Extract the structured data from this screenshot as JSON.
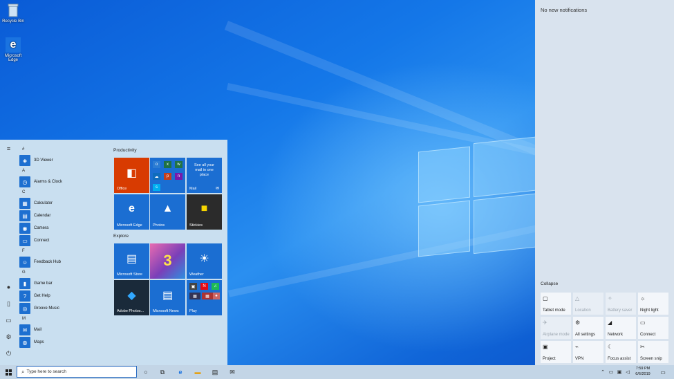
{
  "desktop": {
    "icons": [
      {
        "label": "Recycle Bin",
        "icon": "recycle-bin-icon"
      },
      {
        "label": "Microsoft Edge",
        "icon": "edge-icon"
      }
    ]
  },
  "action_center": {
    "no_notifications": "No new notifications",
    "collapse": "Collapse",
    "quick_actions": [
      {
        "label": "Tablet mode",
        "icon": "tablet-icon",
        "glyph": "▢",
        "enabled": true
      },
      {
        "label": "Location",
        "icon": "location-icon",
        "glyph": "△",
        "enabled": false
      },
      {
        "label": "Battery saver",
        "icon": "battery-icon",
        "glyph": "✧",
        "enabled": false
      },
      {
        "label": "Night light",
        "icon": "brightness-icon",
        "glyph": "☼",
        "enabled": true
      },
      {
        "label": "Airplane mode",
        "icon": "airplane-icon",
        "glyph": "✈",
        "enabled": false
      },
      {
        "label": "All settings",
        "icon": "gear-icon",
        "glyph": "⚙",
        "enabled": true
      },
      {
        "label": "Network",
        "icon": "network-icon",
        "glyph": "◢",
        "enabled": true
      },
      {
        "label": "Connect",
        "icon": "connect-icon",
        "glyph": "▭",
        "enabled": true
      },
      {
        "label": "Project",
        "icon": "project-icon",
        "glyph": "▣",
        "enabled": true
      },
      {
        "label": "VPN",
        "icon": "vpn-icon",
        "glyph": "⌁",
        "enabled": true
      },
      {
        "label": "Focus assist",
        "icon": "moon-icon",
        "glyph": "☾",
        "enabled": true
      },
      {
        "label": "Screen snip",
        "icon": "snip-icon",
        "glyph": "✂",
        "enabled": true
      }
    ]
  },
  "start_menu": {
    "rail": [
      {
        "name": "hamburger-menu-icon",
        "glyph": "≡"
      },
      {
        "name": "user-avatar-icon",
        "glyph": "●"
      },
      {
        "name": "documents-icon",
        "glyph": "▯"
      },
      {
        "name": "pictures-icon",
        "glyph": "▭"
      },
      {
        "name": "settings-icon",
        "glyph": "⚙"
      },
      {
        "name": "power-icon",
        "glyph": "⏻"
      }
    ],
    "groups": [
      {
        "letter": "#",
        "apps": [
          {
            "label": "3D Viewer",
            "glyph": "◈"
          }
        ]
      },
      {
        "letter": "A",
        "apps": [
          {
            "label": "Alarms & Clock",
            "glyph": "◷"
          }
        ]
      },
      {
        "letter": "C",
        "apps": [
          {
            "label": "Calculator",
            "glyph": "▦"
          },
          {
            "label": "Calendar",
            "glyph": "▤"
          },
          {
            "label": "Camera",
            "glyph": "◉"
          },
          {
            "label": "Connect",
            "glyph": "▭"
          }
        ]
      },
      {
        "letter": "F",
        "apps": [
          {
            "label": "Feedback Hub",
            "glyph": "☺"
          }
        ]
      },
      {
        "letter": "G",
        "apps": [
          {
            "label": "Game bar",
            "glyph": "▮"
          },
          {
            "label": "Get Help",
            "glyph": "?"
          },
          {
            "label": "Groove Music",
            "glyph": "◎"
          }
        ]
      },
      {
        "letter": "M",
        "apps": [
          {
            "label": "Mail",
            "glyph": "✉"
          },
          {
            "label": "Maps",
            "glyph": "◍"
          }
        ]
      }
    ],
    "productivity_title": "Productivity",
    "explore_title": "Explore",
    "tiles": {
      "office": {
        "label": "Office",
        "glyph": "◧",
        "color": "#d83b01"
      },
      "mail": {
        "label": "Mail",
        "text": "See all your mail in one place",
        "color": "#1b6ed2"
      },
      "edge": {
        "label": "Microsoft Edge",
        "glyph": "e",
        "color": "#1b6ed2"
      },
      "photos": {
        "label": "Photos",
        "glyph": "▲",
        "color": "#1b6ed2"
      },
      "stickies": {
        "label": "Stickies",
        "glyph": "■",
        "color": "#2b2b2b"
      },
      "store": {
        "label": "Microsoft Store",
        "glyph": "▤",
        "color": "#1b6ed2"
      },
      "game": {
        "label": "",
        "glyph": "3",
        "color": "#7b3fb8"
      },
      "weather": {
        "label": "Weather",
        "glyph": "☀",
        "color": "#1b6ed2"
      },
      "adobe": {
        "label": "Adobe Photos...",
        "glyph": "◆",
        "color": "#1a2a3a"
      },
      "news": {
        "label": "Microsoft News",
        "glyph": "▤",
        "color": "#1b6ed2"
      },
      "play": {
        "label": "Play",
        "color": "#1b6ed2"
      }
    }
  },
  "taskbar": {
    "search_placeholder": "Type here to search",
    "time": "7:59 PM",
    "date": "6/6/2019"
  },
  "colors": {
    "accent": "#1b6ed2",
    "start_bg": "#c9dff0",
    "action_bg": "#d9e3ee",
    "taskbar_bg": "#c3d5e6"
  }
}
